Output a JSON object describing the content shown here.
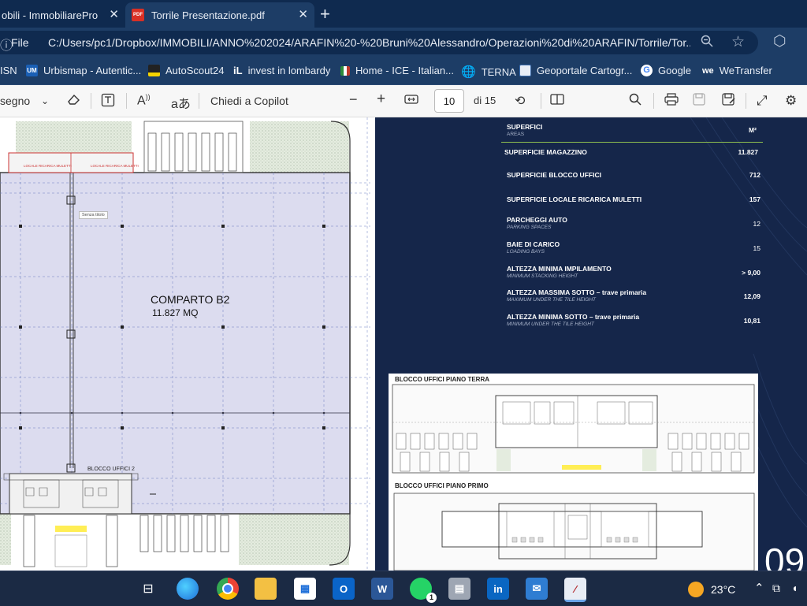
{
  "tabs": [
    {
      "title": "obili - ImmobiliarePro",
      "close": "✕"
    },
    {
      "title": "Torrile Presentazione.pdf",
      "close": "✕",
      "icon": "PDF"
    }
  ],
  "new_tab": "+",
  "address": {
    "label": "File",
    "url": "C:/Users/pc1/Dropbox/IMMOBILI/ANNO%202024/ARAFIN%20-%20Bruni%20Alessandro/Operazioni%20di%20ARAFIN/Torrile/Tor..."
  },
  "bookmarks": [
    {
      "label": "ISN",
      "icon_color": "#1f6feb"
    },
    {
      "label": "Urbismap - Autentic...",
      "icon": "UM",
      "icon_color": "#1a5fb4"
    },
    {
      "label": "AutoScout24",
      "icon_color": "#f5d300"
    },
    {
      "label": "invest in lombardy",
      "icon": "iL",
      "icon_color": "#2b5a8a"
    },
    {
      "label": "Home - ICE - Italian...",
      "icon_color": "#c0392b"
    },
    {
      "label": "TERNA",
      "icon": "globe-icon",
      "icon_color": "#9aa7bb"
    },
    {
      "label": "Geoportale Cartogr...",
      "icon_color": "#3d6fb0"
    },
    {
      "label": "Google",
      "icon": "G",
      "icon_color": "#ffffff"
    },
    {
      "label": "WeTransfer",
      "icon": "we",
      "icon_color": "#111111"
    }
  ],
  "pdf_toolbar": {
    "draw_label": "segno",
    "copilot_label": "Chiedi a Copilot",
    "current_page": "10",
    "page_of": "di 15",
    "minus": "−",
    "plus": "+"
  },
  "plan": {
    "title": "COMPARTO B2",
    "area": "11.827 MQ",
    "tooltip": "Senza titolo",
    "top_label_left": "LOCALE RICARICA MULETTI",
    "top_label_right": "LOCALE RICARICA MULETTI",
    "office_label": "BLOCCO UFFICI 2"
  },
  "surfaces": {
    "header": "SUPERFICI",
    "header_sub": "AREAS",
    "unit": "M²",
    "rows": [
      {
        "label": "SUPERFICIE  MAGAZZINO",
        "sub": "",
        "value": "11.827"
      },
      {
        "label": "SUPERFICIE BLOCCO UFFICI",
        "sub": "",
        "value": "712"
      },
      {
        "label": "SUPERFICIE LOCALE RICARICA MULETTI",
        "sub": "",
        "value": "157"
      },
      {
        "label": "PARCHEGGI AUTO",
        "sub": "PARKING SPACES",
        "value": "12"
      },
      {
        "label": "BAIE DI CARICO",
        "sub": "LOADING BAYS",
        "value": "15"
      },
      {
        "label": "ALTEZZA MINIMA IMPILAMENTO",
        "sub": "MINIMUM STACKING HEIGHT",
        "value": "> 9,00"
      },
      {
        "label": "ALTEZZA MASSIMA SOTTO – trave primaria",
        "sub": "MAXIMUM UNDER THE TILE HEIGHT",
        "value": "12,09"
      },
      {
        "label": "ALTEZZA MINIMA SOTTO – trave primaria",
        "sub": "MINIMUM UNDER THE TILE HEIGHT",
        "value": "10,81"
      }
    ]
  },
  "plans": {
    "ground_floor": "BLOCCO UFFICI  PIANO TERRA",
    "first_floor": "BLOCCO UFFICI  PIANO PRIMO"
  },
  "page_number": "09",
  "taskbar": {
    "temperature": "23°C",
    "whatsapp_badge": "1"
  }
}
